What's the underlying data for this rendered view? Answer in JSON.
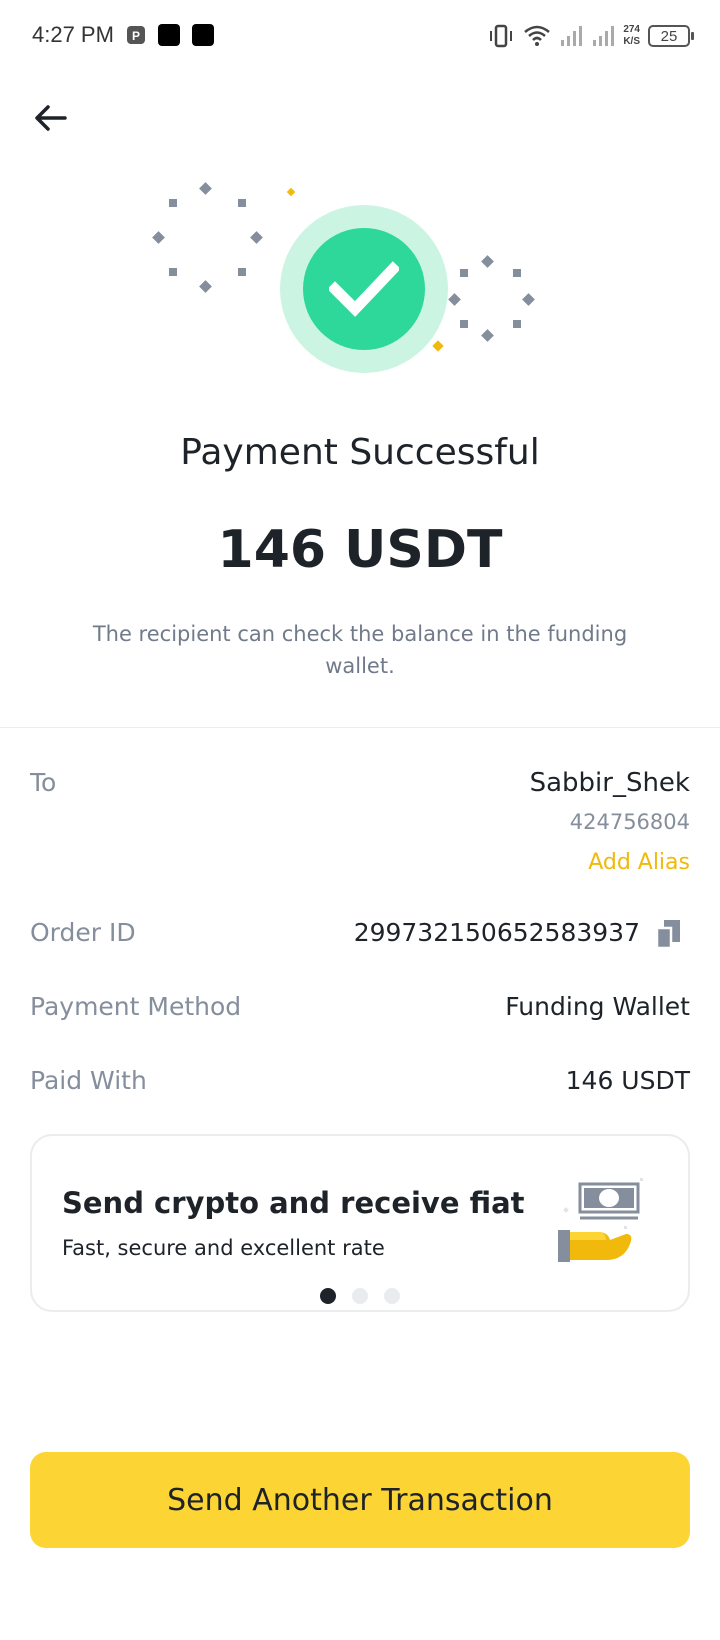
{
  "status_bar": {
    "time": "4:27 PM",
    "net_speed_value": "274",
    "net_speed_unit": "K/S",
    "battery": "25"
  },
  "success": {
    "title": "Payment Successful",
    "amount": "146 USDT",
    "note": "The recipient can check the balance in the funding wallet.",
    "check_color": "#2ed89a"
  },
  "details": {
    "to_label": "To",
    "to_name": "Sabbir_Shek",
    "to_id": "424756804",
    "add_alias": "Add Alias",
    "order_id_label": "Order ID",
    "order_id_value": "299732150652583937",
    "payment_method_label": "Payment Method",
    "payment_method_value": "Funding Wallet",
    "paid_with_label": "Paid With",
    "paid_with_value": "146 USDT"
  },
  "promo": {
    "title": "Send crypto and receive fiat",
    "subtitle": "Fast, secure and excellent rate",
    "pages": 3,
    "active_page": 1
  },
  "actions": {
    "send_another": "Send Another Transaction"
  },
  "colors": {
    "accent": "#fcd535",
    "link": "#f0b90b",
    "success": "#2ed89a"
  }
}
